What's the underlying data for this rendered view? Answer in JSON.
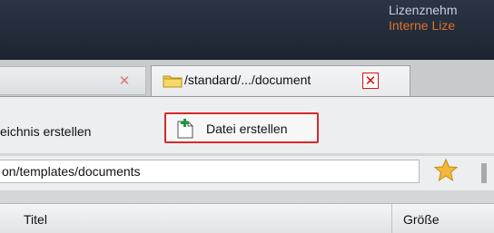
{
  "header": {
    "license_line1": "Lizenznehm",
    "license_line2": "Interne Lize"
  },
  "tabs": [
    {
      "label": "",
      "close_glyph": "✕"
    },
    {
      "label": "/standard/.../document",
      "close_glyph": "✕"
    }
  ],
  "toolbar": {
    "create_folder_label": "eichnis erstellen",
    "create_file_label": "Datei erstellen"
  },
  "path": {
    "value": "on/templates/documents"
  },
  "columns": {
    "title": "Titel",
    "size": "Größe"
  },
  "colors": {
    "header_bg": "#1c2431",
    "accent_orange": "#e0702a",
    "highlight_red": "#d42a2a"
  },
  "icons": [
    "folder-icon",
    "close-icon",
    "new-file-icon",
    "star-icon"
  ]
}
